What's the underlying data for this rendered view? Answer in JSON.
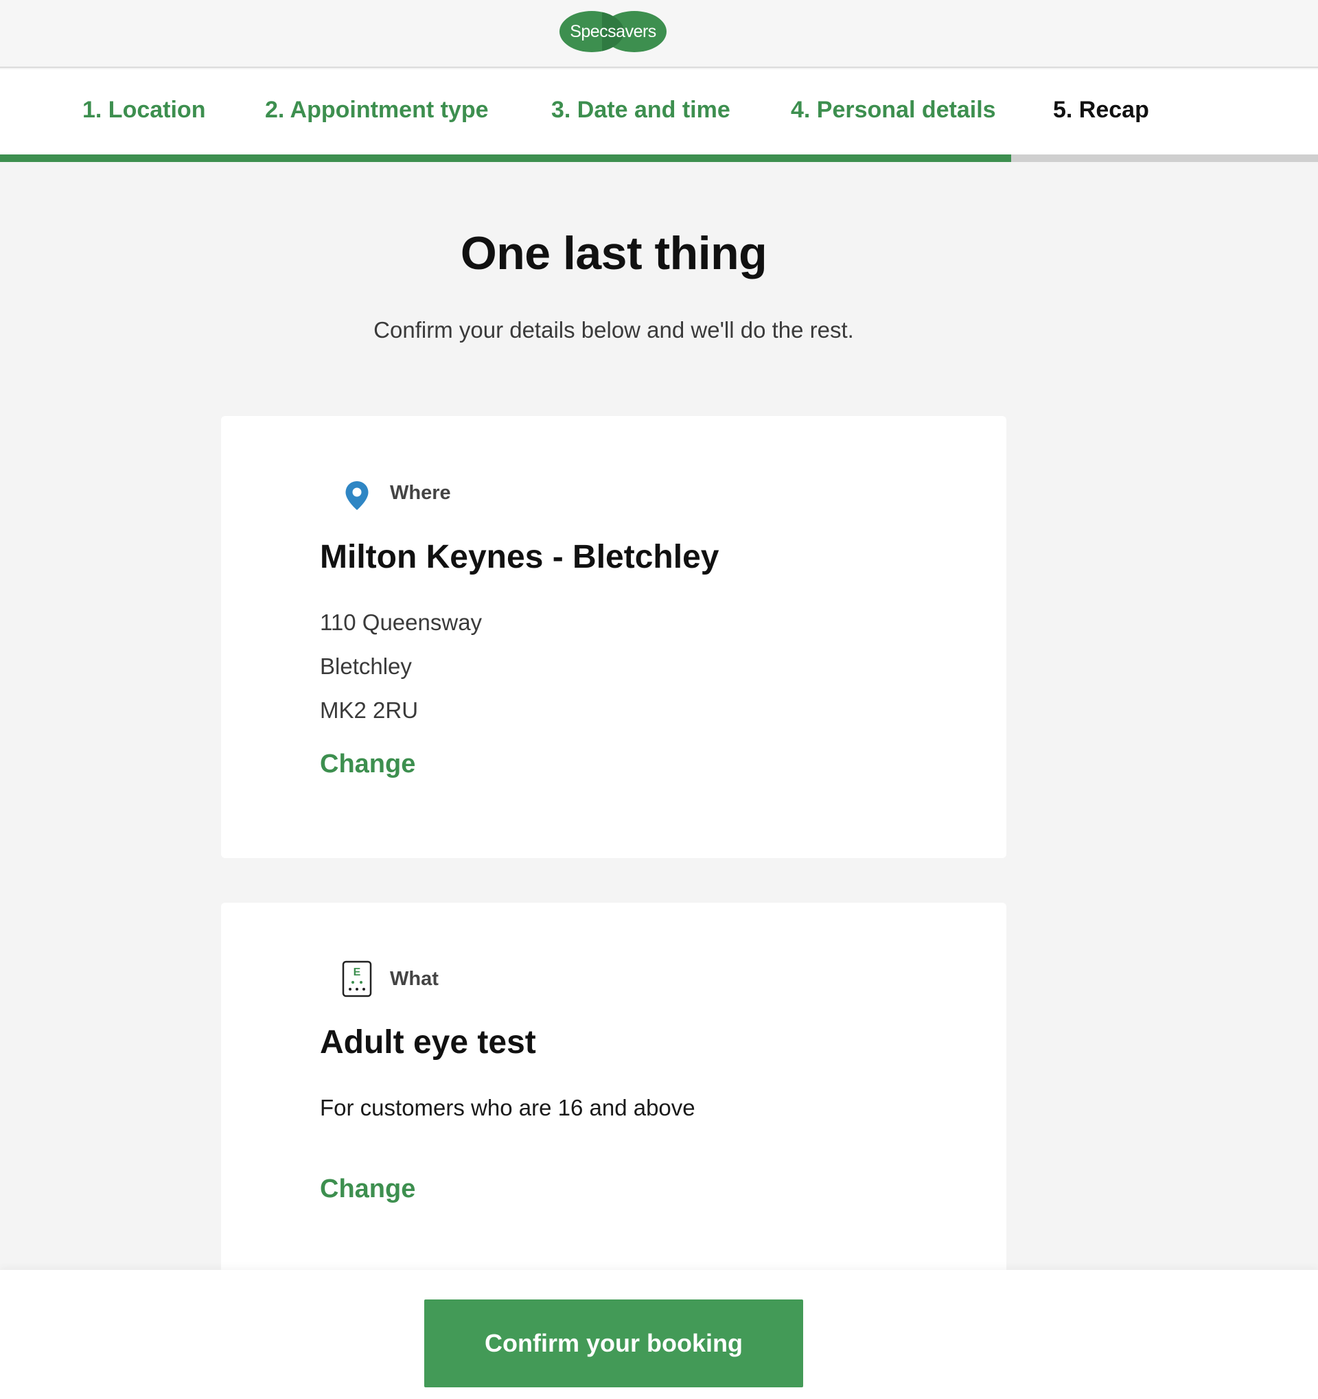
{
  "brand": {
    "logo_text": "Specsavers",
    "color": "#3d8f4f"
  },
  "steps": [
    {
      "label": "1. Location",
      "state": "completed"
    },
    {
      "label": "2. Appointment type",
      "state": "completed"
    },
    {
      "label": "3. Date and time",
      "state": "completed"
    },
    {
      "label": "4. Personal details",
      "state": "completed"
    },
    {
      "label": "5. Recap",
      "state": "current"
    }
  ],
  "progress": {
    "completed_fraction": 0.8
  },
  "main": {
    "title": "One last thing",
    "subtitle": "Confirm your details below and we'll do the rest."
  },
  "where": {
    "icon": "location-pin-icon",
    "label": "Where",
    "store_name": "Milton Keynes - Bletchley",
    "address": [
      "110 Queensway",
      "Bletchley",
      "MK2 2RU"
    ],
    "change_label": "Change"
  },
  "what": {
    "icon": "eye-chart-icon",
    "label": "What",
    "appointment_name": "Adult eye test",
    "description": "For customers who are 16 and above",
    "change_label": "Change"
  },
  "footer": {
    "confirm_label": "Confirm your booking"
  },
  "colors": {
    "accent": "#3d8f4f",
    "button": "#439a57",
    "pin": "#2f86c4"
  }
}
